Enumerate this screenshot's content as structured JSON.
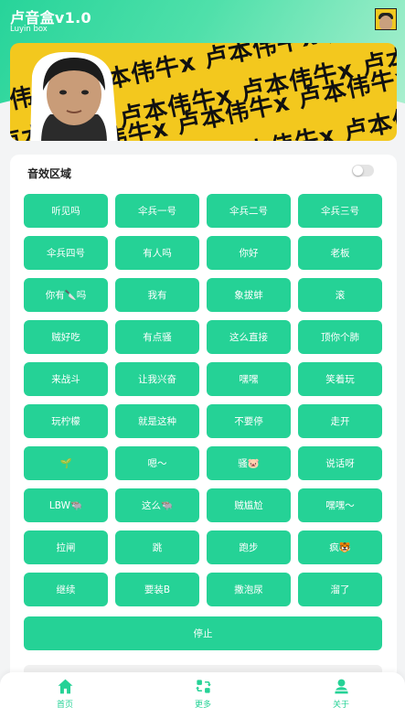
{
  "app": {
    "title": "卢音盒v1.0",
    "subtitle": "Luyin box"
  },
  "banner": {
    "pattern_text": "卢本伟牛x 卢本伟牛x 卢本伟牛x 卢本伟牛x 卢本伟牛x"
  },
  "sound_section": {
    "title": "音效区域",
    "toggle_on": false,
    "buttons": [
      "听见吗",
      "伞兵一号",
      "伞兵二号",
      "伞兵三号",
      "伞兵四号",
      "有人吗",
      "你好",
      "老板",
      "你有🔪吗",
      "我有",
      "象拔蚌",
      "滚",
      "贼好吃",
      "有点骚",
      "这么直接",
      "顶你个肺",
      "来战斗",
      "让我兴奋",
      "嘿嘿",
      "笑着玩",
      "玩柠檬",
      "就是这种",
      "不要停",
      "走开",
      "🌱",
      "嗯～",
      "骚🐷",
      "说话呀",
      "LBW🐃",
      "这么🐃",
      "贼尴尬",
      "嘿嘿～",
      "拉闸",
      "跳",
      "跑步",
      "疯🐯",
      "继续",
      "要装B",
      "撒泡尿",
      "溜了"
    ],
    "stop_label": "停止"
  },
  "tabbar": {
    "items": [
      {
        "label": "首页",
        "icon": "home-icon"
      },
      {
        "label": "更多",
        "icon": "swap-icon"
      },
      {
        "label": "关于",
        "icon": "user-icon"
      }
    ]
  },
  "colors": {
    "accent": "#25d296",
    "banner_yellow": "#f3c81e"
  }
}
